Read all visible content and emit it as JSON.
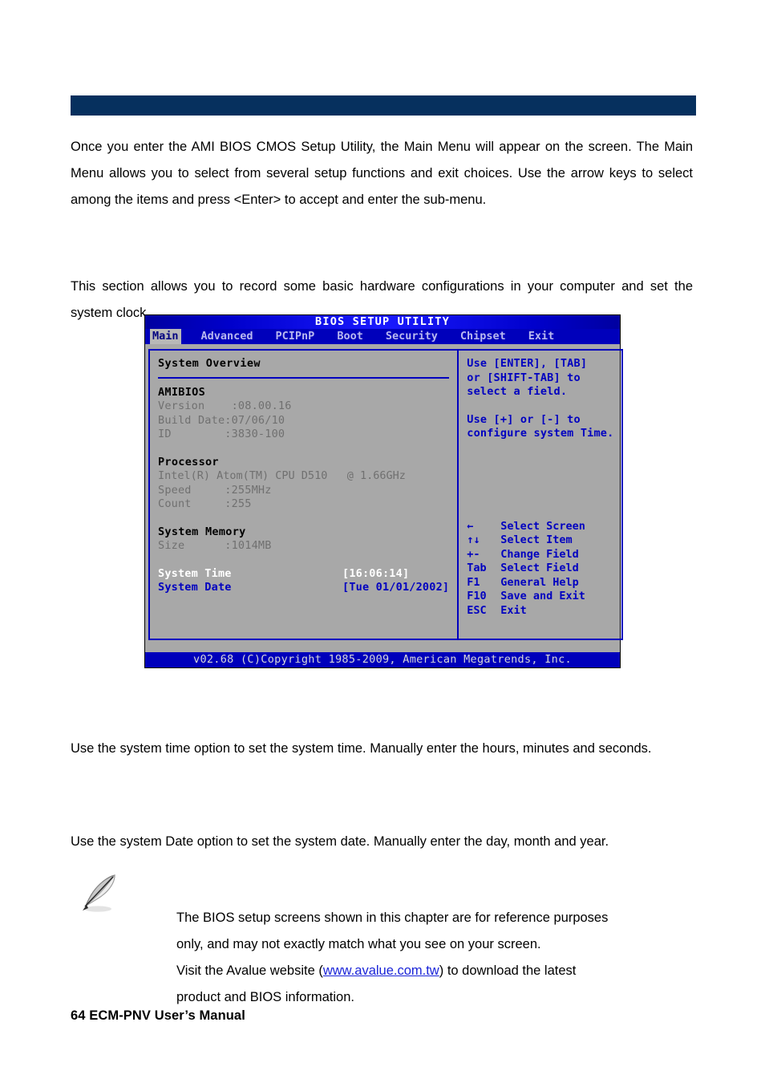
{
  "document": {
    "section_bar": "",
    "paragraphs": {
      "intro": "Once you enter the AMI BIOS CMOS Setup Utility, the Main Menu will appear on the screen. The Main Menu allows you to select from several setup functions and exit choices. Use the arrow keys to select among the items and press <Enter> to accept and enter the sub-menu.",
      "basic": "This section allows you to record some basic hardware configurations in your computer and set the system clock.",
      "system_time": "Use the system time option to set the system time. Manually enter the hours, minutes and seconds.",
      "system_date": "Use the system Date option to set the system date. Manually enter the day, month and year."
    },
    "note": {
      "icon": "feather-pen-icon",
      "line1": "The BIOS setup screens shown in this chapter are for reference purposes",
      "line2": "only, and may not exactly match what you see on your screen.",
      "line3_pre": "Visit the Avalue website (",
      "link_text": "www.avalue.com.tw",
      "line3_post": ") to download the latest",
      "line4": "product and BIOS information."
    },
    "footer": "64 ECM-PNV User’s Manual"
  },
  "bios": {
    "title": "BIOS SETUP UTILITY",
    "tabs": [
      {
        "label": "Main",
        "active": true
      },
      {
        "label": "Advanced",
        "active": false
      },
      {
        "label": "PCIPnP",
        "active": false
      },
      {
        "label": "Boot",
        "active": false
      },
      {
        "label": "Security",
        "active": false
      },
      {
        "label": "Chipset",
        "active": false
      },
      {
        "label": "Exit",
        "active": false
      }
    ],
    "overview_title": "System Overview",
    "amibios": {
      "heading": "AMIBIOS",
      "version_label": "Version",
      "version_value": ":08.00.16",
      "build_label": "Build Date",
      "build_value": ":07/06/10",
      "id_label": "ID",
      "id_value": ":3830-100"
    },
    "processor": {
      "heading": "Processor",
      "model": "Intel(R) Atom(TM) CPU D510   @ 1.66GHz",
      "speed_label": "Speed",
      "speed_value": ":255MHz",
      "count_label": "Count",
      "count_value": ":255"
    },
    "memory": {
      "heading": "System Memory",
      "size_label": "Size",
      "size_value": ":1014MB"
    },
    "settings": [
      {
        "label": "System Time",
        "value": "[16:06:14]",
        "selected": true
      },
      {
        "label": "System Date",
        "value": "[Tue 01/01/2002]",
        "selected": false
      }
    ],
    "help": {
      "line1": "Use [ENTER], [TAB]",
      "line2": "or [SHIFT-TAB] to",
      "line3": "select a field.",
      "line4": "Use [+] or [-] to",
      "line5": "configure system Time."
    },
    "legend": [
      {
        "key": "←",
        "action": "Select Screen"
      },
      {
        "key": "↑↓",
        "action": "Select Item"
      },
      {
        "key": "+-",
        "action": "Change Field"
      },
      {
        "key": "Tab",
        "action": "Select Field"
      },
      {
        "key": "F1",
        "action": "General Help"
      },
      {
        "key": "F10",
        "action": "Save and Exit"
      },
      {
        "key": "ESC",
        "action": "Exit"
      }
    ],
    "footer": "v02.68 (C)Copyright 1985-2009, American Megatrends, Inc."
  },
  "colors": {
    "section_bar": "#06305e",
    "bios_blue": "#0000bb",
    "bios_gray": "#a8a8a8",
    "link": "#1a24d8"
  }
}
